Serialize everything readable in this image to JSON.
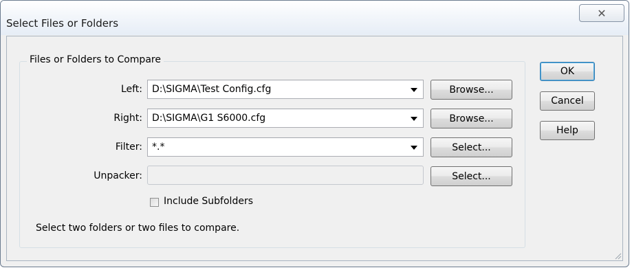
{
  "window": {
    "title": "Select Files or Folders",
    "close_glyph": "✕"
  },
  "group": {
    "legend": "Files or Folders to Compare"
  },
  "fields": {
    "left": {
      "label": "Left:",
      "value": "D:\\SIGMA\\Test Config.cfg",
      "button": "Browse..."
    },
    "right": {
      "label": "Right:",
      "value": "D:\\SIGMA\\G1 S6000.cfg",
      "button": "Browse..."
    },
    "filter": {
      "label": "Filter:",
      "value": "*.*",
      "button": "Select..."
    },
    "unpacker": {
      "label": "Unpacker:",
      "value": "",
      "button": "Select..."
    }
  },
  "options": {
    "include_subfolders_label": "Include Subfolders",
    "include_subfolders_checked": false
  },
  "status": "Select two folders or two files to compare.",
  "actions": {
    "ok": "OK",
    "cancel": "Cancel",
    "help": "Help"
  },
  "colors": {
    "accent_border": "#3c7fb1",
    "window_bg": "#f0f0f0"
  },
  "icons": {
    "close": "close-icon",
    "dropdown": "chevron-down-icon",
    "resize": "resize-grip-icon"
  }
}
